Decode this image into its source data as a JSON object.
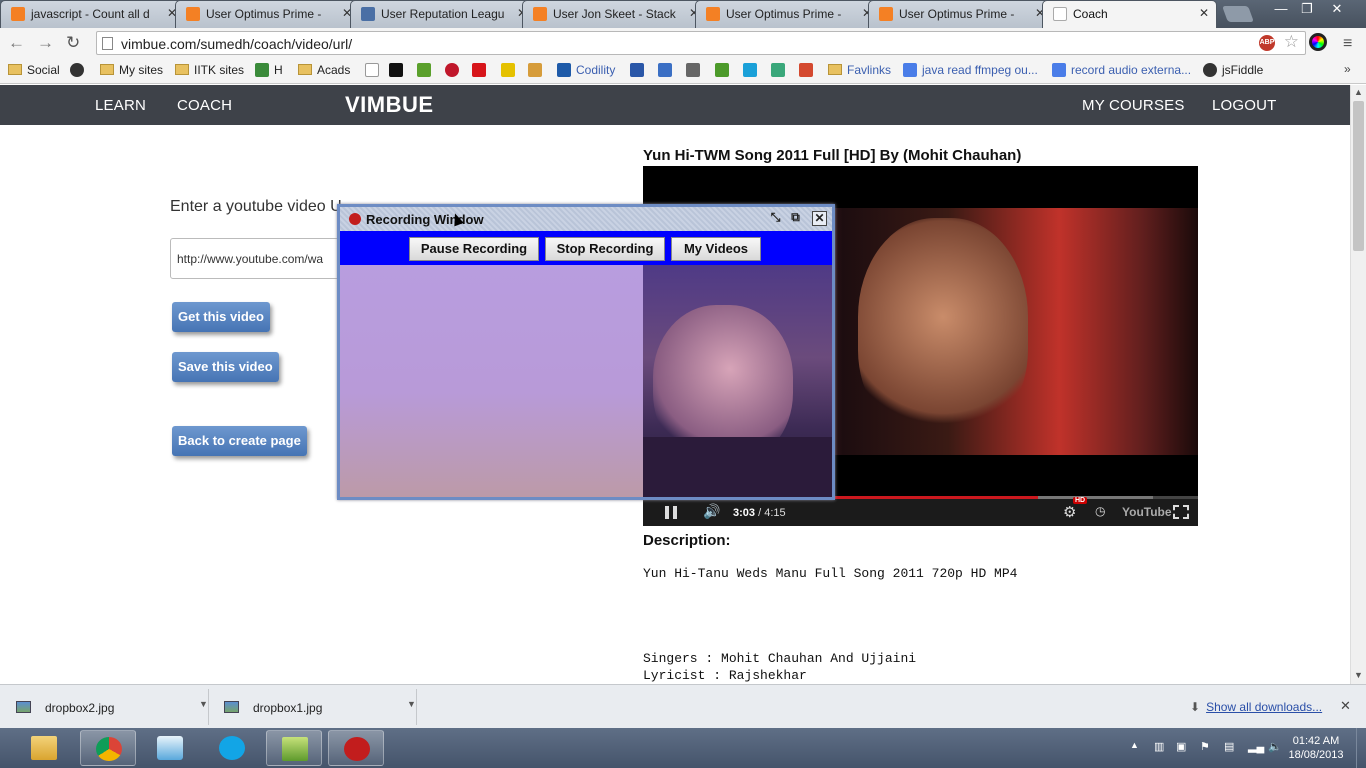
{
  "browser": {
    "tabs": [
      {
        "title": "javascript - Count all d",
        "active": false
      },
      {
        "title": "User Optimus Prime -",
        "active": false
      },
      {
        "title": "User Reputation Leagu",
        "active": false
      },
      {
        "title": "User Jon Skeet - Stack",
        "active": false
      },
      {
        "title": "User Optimus Prime -",
        "active": false
      },
      {
        "title": "User Optimus Prime -",
        "active": false
      },
      {
        "title": "Coach",
        "active": true
      }
    ],
    "url": "vimbue.com/sumedh/coach/video/url/",
    "abp_label": "ABP",
    "bookmarks": [
      {
        "label": "Social",
        "type": "folder"
      },
      {
        "label": "",
        "type": "icon"
      },
      {
        "label": "My sites",
        "type": "folder"
      },
      {
        "label": "IITK sites",
        "type": "folder"
      },
      {
        "label": "H",
        "type": "icon"
      },
      {
        "label": "Acads",
        "type": "folder"
      },
      {
        "label": "Codility",
        "type": "link"
      },
      {
        "label": "Favlinks",
        "type": "folder"
      },
      {
        "label": "java read ffmpeg ou...",
        "type": "link"
      },
      {
        "label": "record audio externa...",
        "type": "link"
      },
      {
        "label": "jsFiddle",
        "type": "link"
      }
    ]
  },
  "site": {
    "nav": {
      "learn": "LEARN",
      "coach": "COACH",
      "logo": "VIMBUE",
      "my_courses": "MY COURSES",
      "logout": "LOGOUT"
    },
    "prompt": "Enter a youtube video U",
    "prompt_tail": "Ua",
    "url_value": "http://www.youtube.com/wa",
    "buttons": {
      "get": "Get this video",
      "save": "Save this video",
      "back": "Back to create page"
    },
    "video": {
      "title": "Yun Hi-TWM Song 2011 Full [HD] By (Mohit Chauhan)",
      "time_current": "3:03",
      "time_total": "/ 4:15",
      "hd_badge": "HD",
      "youtube_label": "YouTube",
      "played_fraction": 0.712,
      "buffered_fraction": 0.919
    },
    "description": {
      "heading": "Description:",
      "line1": "Yun Hi-Tanu Weds Manu Full Song 2011 720p HD MP4",
      "line2": "Singers : Mohit Chauhan And Ujjaini",
      "line3": "Lyricist : Rajshekhar"
    }
  },
  "recording_window": {
    "title": "Recording Window",
    "pause": "Pause Recording",
    "stop": "Stop Recording",
    "videos": "My Videos"
  },
  "downloads": {
    "items": [
      {
        "name": "dropbox2.jpg"
      },
      {
        "name": "dropbox1.jpg"
      }
    ],
    "show_all": "Show all downloads..."
  },
  "taskbar": {
    "time": "01:42 AM",
    "date": "18/08/2013"
  },
  "colors": {
    "nav_bg": "#3e4249",
    "button_blue": "#4674b4",
    "rec_bar": "#0000ff",
    "rec_body": "#b89ddf",
    "progress_red": "#cc181e"
  }
}
